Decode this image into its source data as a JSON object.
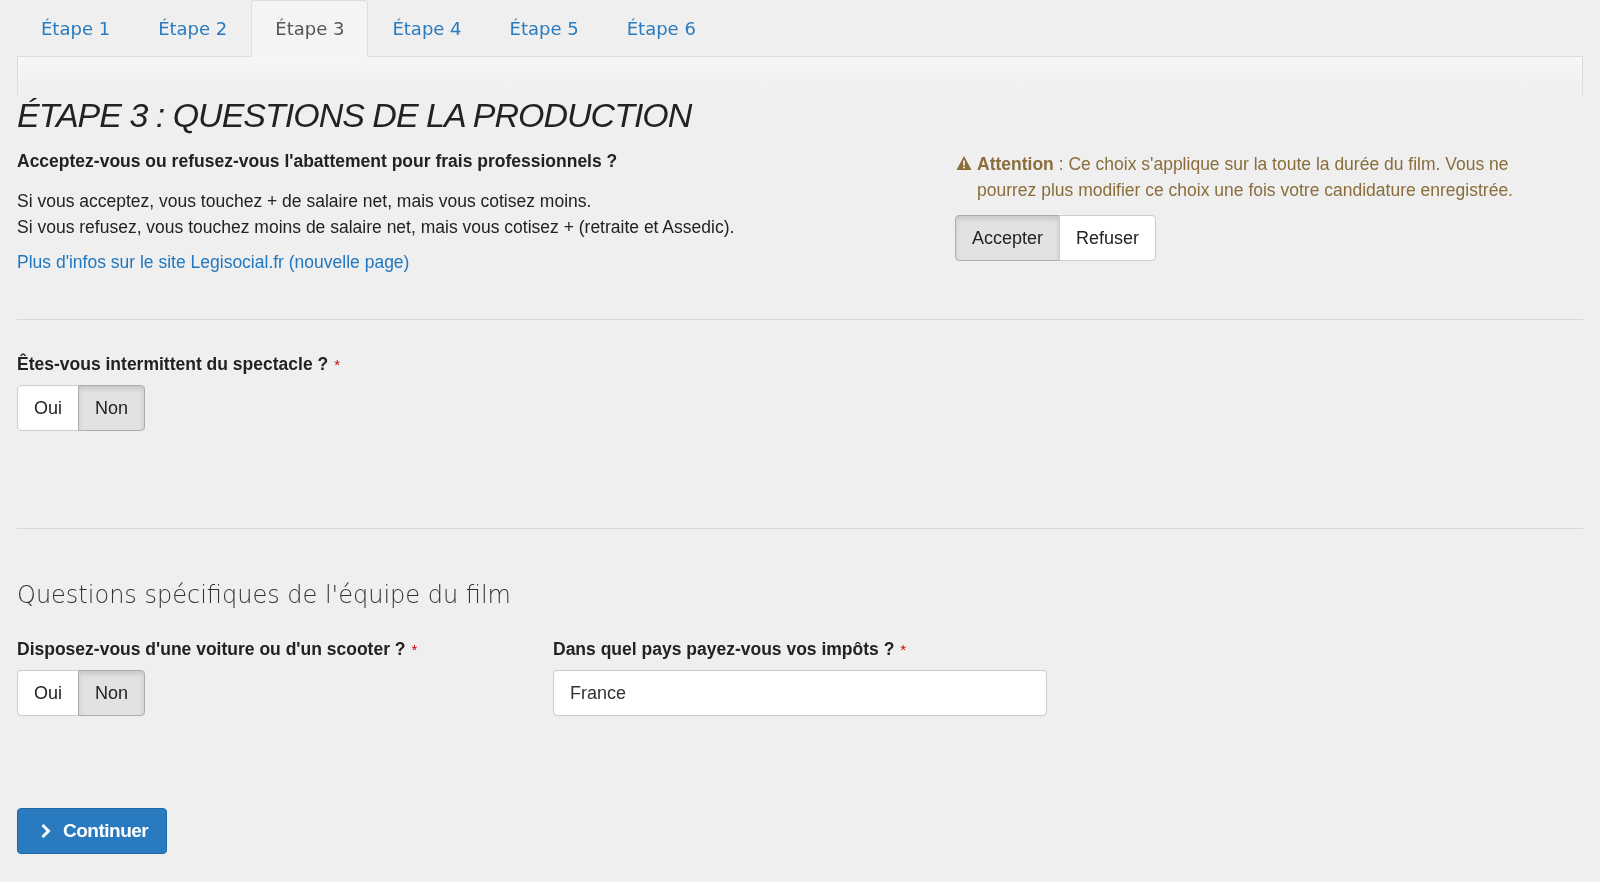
{
  "tabs": [
    {
      "label": "Étape 1",
      "selected": false
    },
    {
      "label": "Étape 2",
      "selected": false
    },
    {
      "label": "Étape 3",
      "selected": true
    },
    {
      "label": "Étape 4",
      "selected": false
    },
    {
      "label": "Étape 5",
      "selected": false
    },
    {
      "label": "Étape 6",
      "selected": false
    }
  ],
  "heading": "ÉTAPE 3 : QUESTIONS DE LA PRODUCTION",
  "abatement": {
    "question": "Acceptez-vous ou refusez-vous l'abattement pour frais professionnels ?",
    "lines": [
      "Si vous acceptez, vous touchez + de salaire net, mais vous cotisez moins.",
      "Si vous refusez, vous touchez moins de salaire net, mais vous cotisez + (retraite et Assedic)."
    ],
    "link": "Plus d'infos sur le site Legisocial.fr (nouvelle page)",
    "warning": "**Attention** : Ce choix s'applique sur la toute la durée du film. Vous ne pourrez plus modifier ce choix une fois votre candidature enregistrée.",
    "options": [
      {
        "label": "Accepter",
        "selected": true
      },
      {
        "label": "Refuser",
        "selected": false
      }
    ]
  },
  "intermittent": {
    "label": "Êtes-vous intermittent du spectacle ?",
    "required_mark": "*",
    "options": [
      {
        "label": "Oui",
        "selected": false
      },
      {
        "label": "Non",
        "selected": true
      }
    ]
  },
  "section_title": "Questions spécifiques de l'équipe du film",
  "vehicle": {
    "label": "Disposez-vous d'une voiture ou d'un scooter ?",
    "required_mark": "*",
    "options": [
      {
        "label": "Oui",
        "selected": false
      },
      {
        "label": "Non",
        "selected": true
      }
    ]
  },
  "tax_country": {
    "label": "Dans quel pays payez-vous vos impôts ?",
    "required_mark": "*",
    "value": "France"
  },
  "continue_button": "Continuer"
}
